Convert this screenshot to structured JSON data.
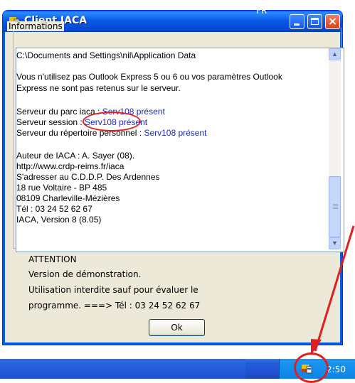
{
  "window": {
    "title": "Client IACA",
    "group_label": "Informations"
  },
  "info": {
    "lines": [
      "C:\\Documents and Settings\\nil\\Application Data",
      "Vous n'utilisez pas Outlook Express 5 ou 6 ou vos paramètres Outlook",
      "Express ne sont pas retenus sur le serveur.",
      "Auteur de IACA : A. Sayer (08).",
      "http://www.crdp-reims.fr/iaca",
      "S'adresser au C.D.D.P. Des Ardennes",
      "18 rue Voltaire - BP 485",
      "08109 Charleville-Mézières",
      "Tél : 03 24 52 62 67",
      "IACA, Version 8 (8.05)"
    ],
    "servers": [
      {
        "label": "Serveur du parc iaca : ",
        "value": "Serv108 présent"
      },
      {
        "label": "Serveur session : ",
        "value": "Serv108 présent"
      },
      {
        "label": "Serveur du répertoire personnel : ",
        "value": "Serv108 présent"
      }
    ]
  },
  "attention": {
    "title": "ATTENTION",
    "line1": "Version de démonstration.",
    "line2": "Utilisation interdite sauf pour évaluer le",
    "line3": "programme. ===> Tél : 03 24 52 62 67"
  },
  "buttons": {
    "ok": "Ok"
  },
  "taskbar": {
    "language": "FR",
    "clock": "2:50"
  },
  "colors": {
    "title_bar": "#0a5ae8",
    "server_text": "#1a2bb8",
    "annotation": "#e02020"
  },
  "icons": [
    "app-icon",
    "minimize-icon",
    "maximize-icon",
    "close-icon",
    "scroll-up-icon",
    "scroll-down-icon",
    "tray-app-icon"
  ]
}
